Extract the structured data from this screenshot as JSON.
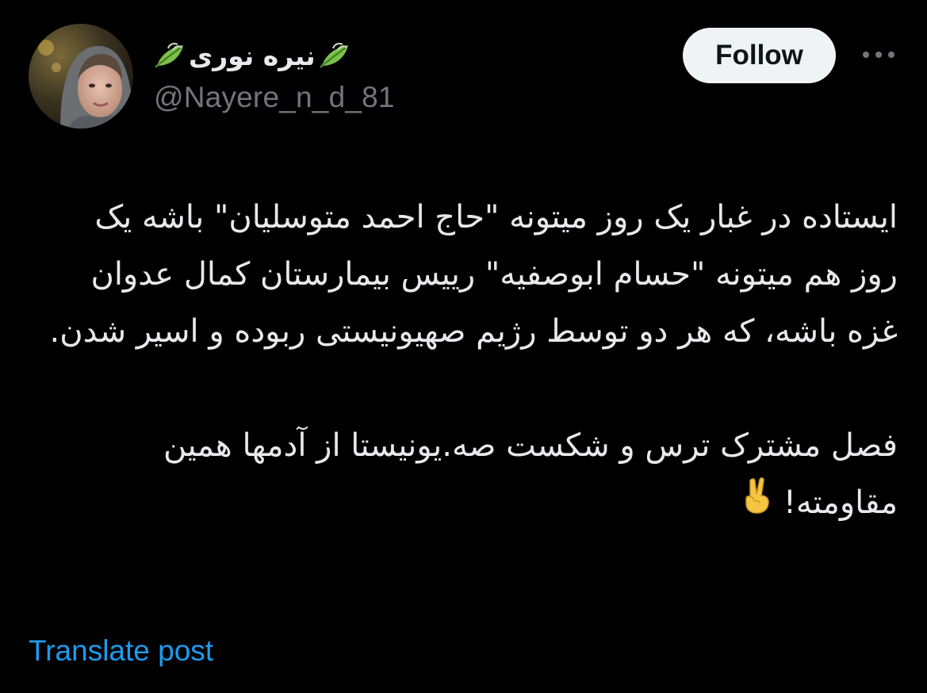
{
  "author": {
    "display_name": "نیره نوری",
    "handle": "@Nayere_n_d_81",
    "avatar_icon": "user-avatar-photo",
    "name_decoration_icon": "leaf-emoji-icon"
  },
  "actions": {
    "follow_label": "Follow",
    "more_icon": "more-options-icon"
  },
  "tweet": {
    "paragraph_1": "ایستاده در غبار یک روز میتونه \"حاج احمد متوسلیان\" باشه یک روز هم میتونه \"حسام ابوصفیه\" رییس بیمارستان کمال عدوان غزه باشه، که هر دو توسط رژیم صهیونیستی ربوده و اسیر شدن.",
    "paragraph_2": "فصل مشترک ترس و شکست صه.یونیستا از آدمها همین مقاومته!",
    "emoji_icon": "victory-hand-icon"
  },
  "translate_label": "Translate post",
  "colors": {
    "background": "#000000",
    "text_primary": "#e7e9ea",
    "text_secondary": "#71767b",
    "link": "#1d9bf0",
    "follow_bg": "#eff3f4"
  }
}
